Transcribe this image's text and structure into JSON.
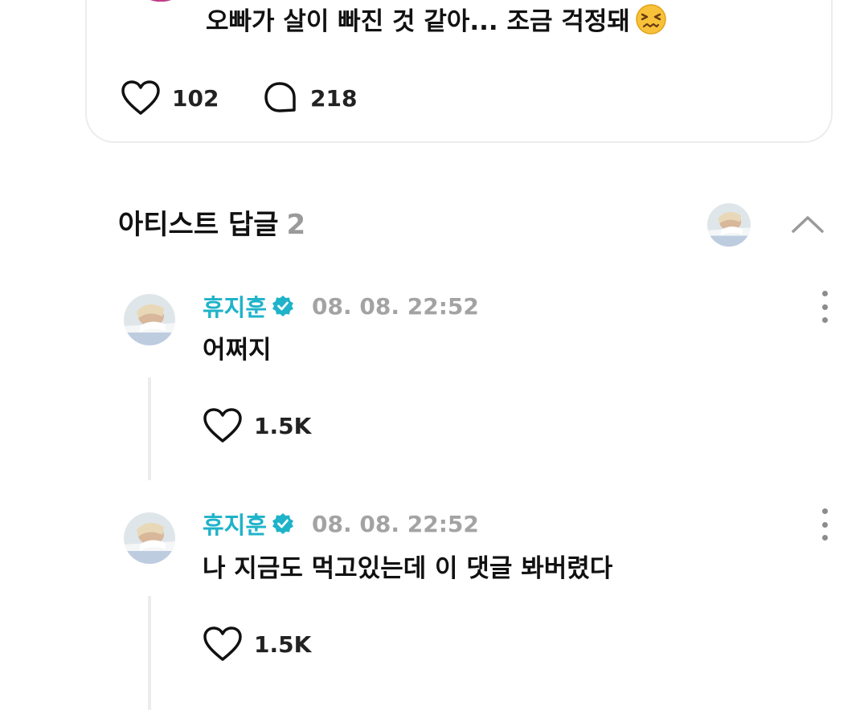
{
  "post": {
    "text": "오빠가 살이 빠진 것 같아... 조금 걱정돼",
    "emoji_icon": "confounded-face-icon",
    "likes": "102",
    "comments": "218"
  },
  "artist_replies": {
    "title": "아티스트 답글",
    "count": "2"
  },
  "comments": [
    {
      "author": "휴지훈",
      "verified": true,
      "time": "08. 08. 22:52",
      "text": "어쩌지",
      "likes": "1.5K"
    },
    {
      "author": "휴지훈",
      "verified": true,
      "time": "08. 08. 22:52",
      "text": "나 지금도 먹고있는데 이 댓글 봐버렸다",
      "likes": "1.5K"
    }
  ],
  "colors": {
    "accent": "#1fb3c9",
    "muted": "#a3a3a3",
    "text": "#111111",
    "divider": "#ececec"
  }
}
